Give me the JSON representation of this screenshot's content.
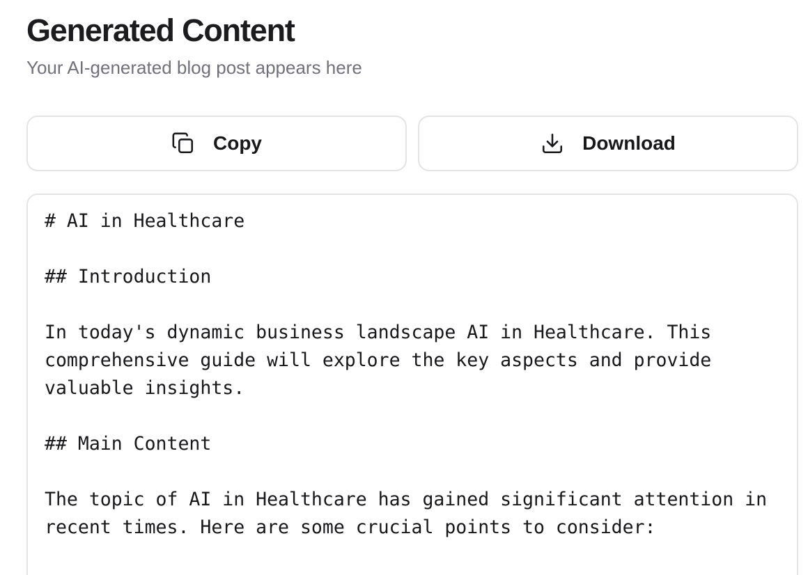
{
  "header": {
    "title": "Generated Content",
    "subtitle": "Your AI-generated blog post appears here"
  },
  "actions": {
    "copy_label": "Copy",
    "copy_icon": "copy-icon",
    "download_label": "Download",
    "download_icon": "download-icon"
  },
  "content": {
    "text": "# AI in Healthcare\n\n## Introduction\n\nIn today's dynamic business landscape AI in Healthcare. This comprehensive guide will explore the key aspects and provide valuable insights.\n\n## Main Content\n\nThe topic of AI in Healthcare has gained significant attention in recent times. Here are some crucial points to consider:"
  },
  "colors": {
    "border": "#e4e4e7",
    "title": "#1c1c1f",
    "subtitle": "#71717a",
    "text": "#18181b"
  }
}
